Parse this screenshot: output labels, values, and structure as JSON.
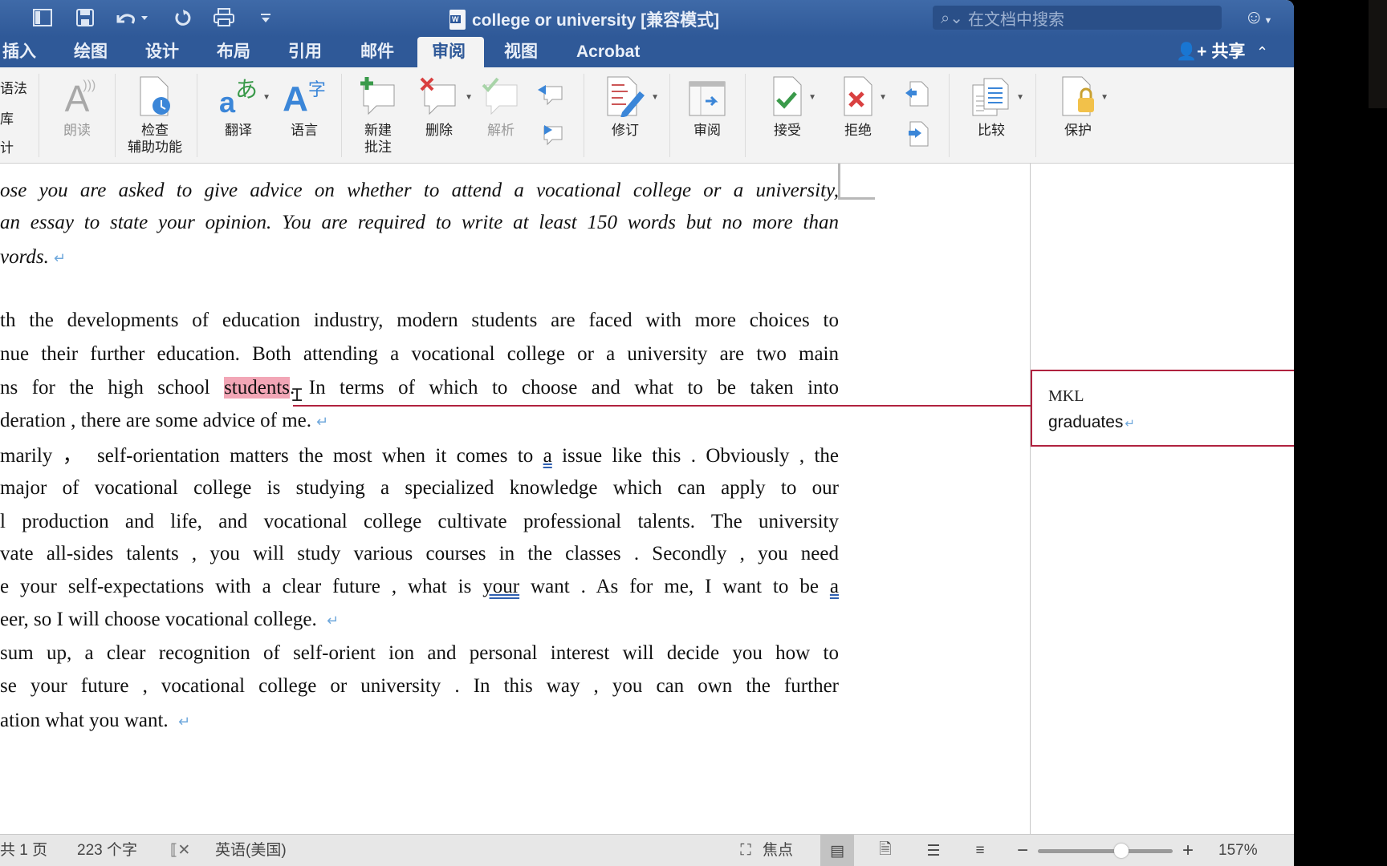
{
  "window": {
    "title": "college or university [兼容模式]",
    "search_placeholder": "在文档中搜索",
    "quick_access": [
      "sidebar-toggle-icon",
      "save-icon",
      "undo-icon",
      "redo-icon",
      "print-icon",
      "customize-icon"
    ]
  },
  "tabs": [
    {
      "label": "插入",
      "active": false
    },
    {
      "label": "绘图",
      "active": false
    },
    {
      "label": "设计",
      "active": false
    },
    {
      "label": "布局",
      "active": false
    },
    {
      "label": "引用",
      "active": false
    },
    {
      "label": "邮件",
      "active": false
    },
    {
      "label": "审阅",
      "active": true
    },
    {
      "label": "视图",
      "active": false
    },
    {
      "label": "Acrobat",
      "active": false
    }
  ],
  "share_label": "共享",
  "ribbon": {
    "left_cut": [
      "语法",
      "库",
      "计"
    ],
    "read_aloud": "朗读",
    "accessibility": [
      "检查",
      "辅助功能"
    ],
    "translate": "翻译",
    "language": "语言",
    "new_comment": [
      "新建",
      "批注"
    ],
    "delete": "删除",
    "resolve": "解析",
    "track_changes": "修订",
    "review": "审阅",
    "accept": "接受",
    "reject": "拒绝",
    "compare": "比较",
    "protect": "保护"
  },
  "document": {
    "lines": [
      {
        "t": "ose you are asked to give advice on whether to attend a vocational college or a university,",
        "style": "it"
      },
      {
        "t": "an essay to state your opinion. You are required to write at least 150 words but no more than",
        "style": "it"
      },
      {
        "t": "vords.",
        "style": "it",
        "end": true
      },
      {
        "t": "th the developments of education industry, modern students are faced with more choices to"
      },
      {
        "t": "nue their further education. Both attending a vocational college or a university are two main"
      },
      {
        "pre": "ns for the high school ",
        "hl": "students",
        "post": ". In terms of which to choose and what to be taken into"
      },
      {
        "t": "deration , there are some advice of me.",
        "end": true
      },
      {
        "pre": "marily  ，  self-orientation matters the most when it comes to ",
        "dbl": "a",
        "post": " issue like this . Obviously , the"
      },
      {
        "t": " major of vocational college is studying a specialized knowledge which can apply to our"
      },
      {
        "t": "l production and life, and vocational college cultivate professional talents. The university"
      },
      {
        "t": "vate all-sides talents , you will study various courses in the classes . Secondly , you need"
      },
      {
        "pre": "e your self-expectations with a clear future , what is ",
        "dbl": "your",
        "post": " want . As for me, I want to be ",
        "dbl2": "a"
      },
      {
        "t": "eer, so I will choose vocational college. ",
        "end": true
      },
      {
        "t": " sum up, a clear recognition of self-orient ion and personal interest will decide you how to"
      },
      {
        "t": "se your future , vocational college or university . In this way , you can own the further"
      },
      {
        "t": "ation what you want. ",
        "end": true
      }
    ],
    "paragraph_mark": "↵"
  },
  "comment": {
    "author": "MKL",
    "text": "graduates"
  },
  "status": {
    "pages": "共 1 页",
    "words": "223 个字",
    "language": "英语(美国)",
    "focus": "焦点",
    "zoom": "157%",
    "zoom_fraction": 0.62
  }
}
